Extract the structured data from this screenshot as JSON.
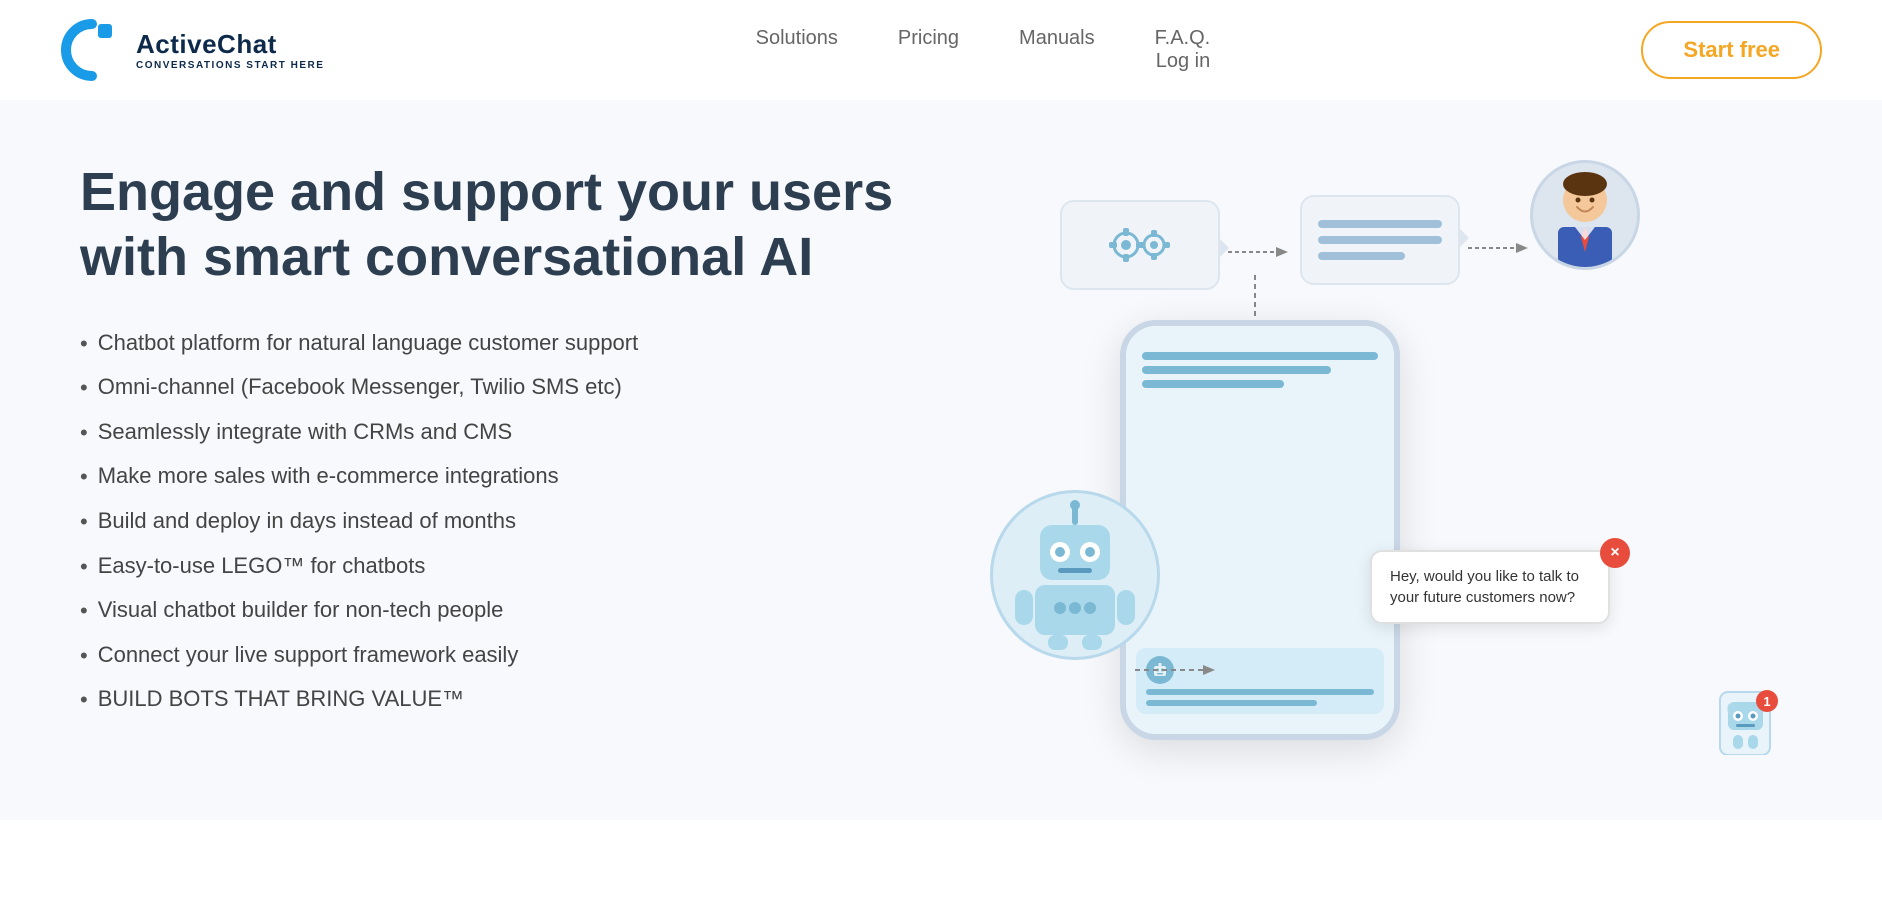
{
  "header": {
    "logo_title": "ActiveChat",
    "logo_subtitle": "CONVERSATIONS START HERE",
    "nav": {
      "solutions": "Solutions",
      "pricing": "Pricing",
      "manuals": "Manuals",
      "faq": "F.A.Q.",
      "login": "Log in"
    },
    "cta": "Start free"
  },
  "hero": {
    "title_line1": "Engage and support your users",
    "title_line2": "with smart conversational AI",
    "features": [
      "Chatbot platform for natural language customer support",
      "Omni-channel (Facebook Messenger, Twilio SMS etc)",
      "Seamlessly integrate with CRMs and CMS",
      "Make more sales with e-commerce integrations",
      "Build and deploy in days instead of months",
      "Easy-to-use LEGO™ for chatbots",
      "Visual chatbot builder for non-tech people",
      "Connect your live support framework easily",
      "BUILD BOTS THAT BRING VALUE™"
    ]
  },
  "chat_popup": {
    "message": "Hey, would you like to talk to your future customers now?"
  },
  "notification_count": "1"
}
